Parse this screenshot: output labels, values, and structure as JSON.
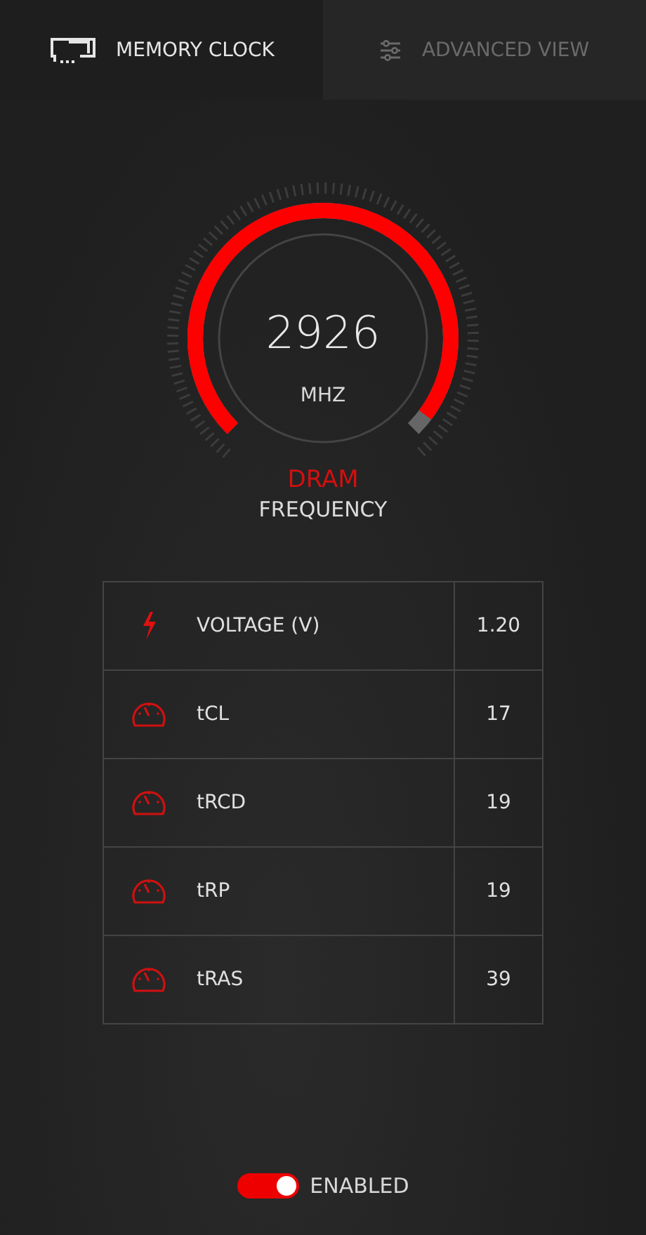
{
  "tabs": [
    {
      "label": "MEMORY CLOCK",
      "kind": "memory",
      "selected": true
    },
    {
      "label": "ADVANCED VIEW",
      "kind": "sliders",
      "selected": false
    }
  ],
  "gauge": {
    "value": "2926",
    "unit": "MHZ",
    "title": "DRAM",
    "subtitle": "FREQUENCY"
  },
  "settings": [
    {
      "kind": "voltage",
      "name": "VOLTAGE (V)",
      "value": "1.20"
    },
    {
      "kind": "timing",
      "name": "tCL",
      "value": "17"
    },
    {
      "kind": "timing",
      "name": "tRCD",
      "value": "19"
    },
    {
      "kind": "timing",
      "name": "tRP",
      "value": "19"
    },
    {
      "kind": "timing",
      "name": "tRAS",
      "value": "39"
    }
  ],
  "toggle": {
    "label": "ENABLED",
    "on": true
  }
}
